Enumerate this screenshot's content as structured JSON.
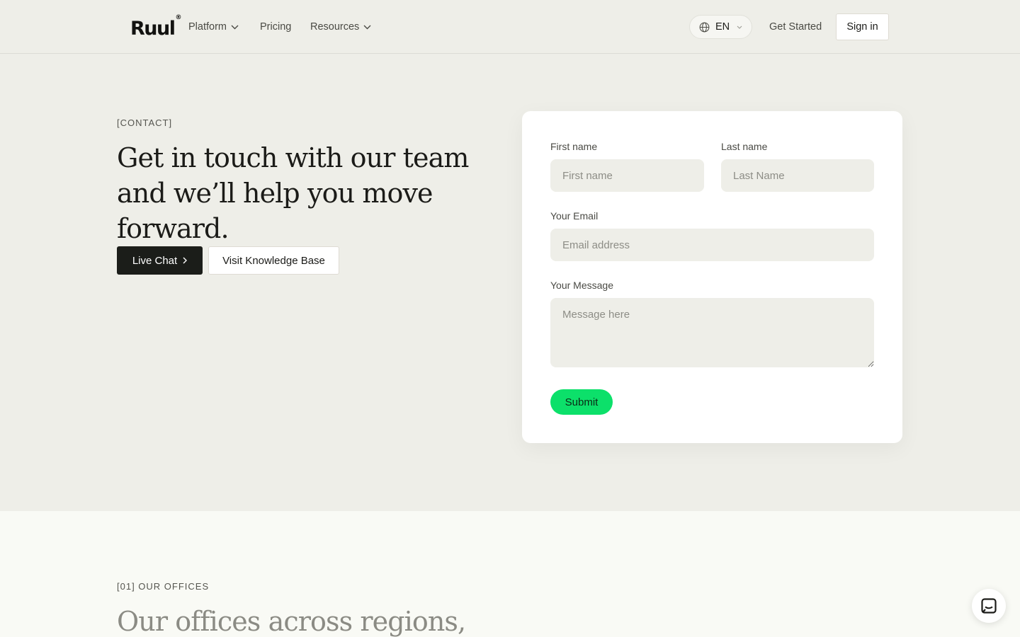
{
  "header": {
    "logo": "Ruul",
    "logo_mark": "®",
    "nav": {
      "platform": "Platform",
      "pricing": "Pricing",
      "resources": "Resources"
    },
    "language": "EN",
    "get_started": "Get Started",
    "sign_in": "Sign in"
  },
  "hero": {
    "eyebrow": "[CONTACT]",
    "headline": "Get in touch with our team and we’ll help you move forward.",
    "live_chat": "Live Chat",
    "knowledge_base": "Visit Knowledge Base"
  },
  "form": {
    "first_name_label": "First name",
    "first_name_placeholder": "First name",
    "first_name_value": "",
    "last_name_label": "Last name",
    "last_name_placeholder": "Last Name",
    "last_name_value": "",
    "email_label": "Your Email",
    "email_placeholder": "Email address",
    "email_value": "",
    "message_label": "Your Message",
    "message_placeholder": "Message here",
    "message_value": "",
    "submit": "Submit"
  },
  "offices": {
    "eyebrow": "[01] OUR OFFICES",
    "title": "Our offices across regions,"
  },
  "icons": {
    "globe": "globe-icon",
    "chevron": "chevron-down-icon",
    "chat_launcher": "chat-icon"
  },
  "colors": {
    "accent_green": "#0ce06a",
    "dark_button": "#1b1d19",
    "page_bg": "#eeeee8"
  }
}
